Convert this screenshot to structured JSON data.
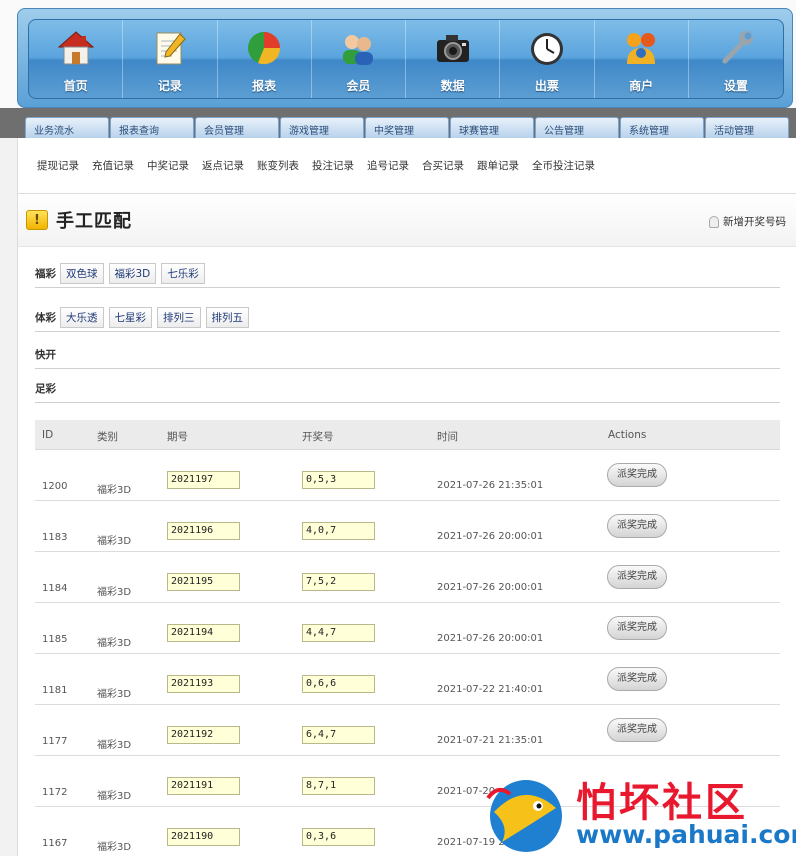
{
  "nav": {
    "items": [
      {
        "label": "首页",
        "icon": "home-icon"
      },
      {
        "label": "记录",
        "icon": "notepad-pencil-icon"
      },
      {
        "label": "报表",
        "icon": "pie-chart-icon"
      },
      {
        "label": "会员",
        "icon": "users-icon"
      },
      {
        "label": "数据",
        "icon": "camera-icon"
      },
      {
        "label": "出票",
        "icon": "clock-icon"
      },
      {
        "label": "商户",
        "icon": "merchant-icon"
      },
      {
        "label": "设置",
        "icon": "wrench-icon"
      }
    ]
  },
  "tabs": [
    "业务流水",
    "报表查询",
    "会员管理",
    "游戏管理",
    "中奖管理",
    "球赛管理",
    "公告管理",
    "系统管理",
    "活动管理"
  ],
  "subnav": [
    "提现记录",
    "充值记录",
    "中奖记录",
    "返点记录",
    "账变列表",
    "投注记录",
    "追号记录",
    "合买记录",
    "跟单记录",
    "全币投注记录"
  ],
  "page": {
    "title": "手工匹配",
    "new_link": "新增开奖号码"
  },
  "categories": {
    "fucai": {
      "label": "福彩",
      "items": [
        "双色球",
        "福彩3D",
        "七乐彩"
      ]
    },
    "ticai": {
      "label": "体彩",
      "items": [
        "大乐透",
        "七星彩",
        "排列三",
        "排列五"
      ]
    },
    "kuaikai": {
      "label": "快开"
    },
    "zucai": {
      "label": "足彩"
    }
  },
  "table": {
    "headers": {
      "id": "ID",
      "type": "类别",
      "issue": "期号",
      "number": "开奖号",
      "time": "时间",
      "actions": "Actions"
    },
    "rows": [
      {
        "id": "1200",
        "type": "福彩3D",
        "issue": "2021197",
        "number": "0,5,3",
        "time": "2021-07-26 21:35:01",
        "action": "派奖完成"
      },
      {
        "id": "1183",
        "type": "福彩3D",
        "issue": "2021196",
        "number": "4,0,7",
        "time": "2021-07-26 20:00:01",
        "action": "派奖完成"
      },
      {
        "id": "1184",
        "type": "福彩3D",
        "issue": "2021195",
        "number": "7,5,2",
        "time": "2021-07-26 20:00:01",
        "action": "派奖完成"
      },
      {
        "id": "1185",
        "type": "福彩3D",
        "issue": "2021194",
        "number": "4,4,7",
        "time": "2021-07-26 20:00:01",
        "action": "派奖完成"
      },
      {
        "id": "1181",
        "type": "福彩3D",
        "issue": "2021193",
        "number": "0,6,6",
        "time": "2021-07-22 21:40:01",
        "action": "派奖完成"
      },
      {
        "id": "1177",
        "type": "福彩3D",
        "issue": "2021192",
        "number": "6,4,7",
        "time": "2021-07-21 21:35:01",
        "action": "派奖完成"
      },
      {
        "id": "1172",
        "type": "福彩3D",
        "issue": "2021191",
        "number": "8,7,1",
        "time": "2021-07-20",
        "action": ""
      },
      {
        "id": "1167",
        "type": "福彩3D",
        "issue": "2021190",
        "number": "0,3,6",
        "time": "2021-07-19 21:35:02",
        "action": ""
      }
    ]
  },
  "watermark": {
    "title": "怕坏社区",
    "url": "www.pahuai.com"
  }
}
